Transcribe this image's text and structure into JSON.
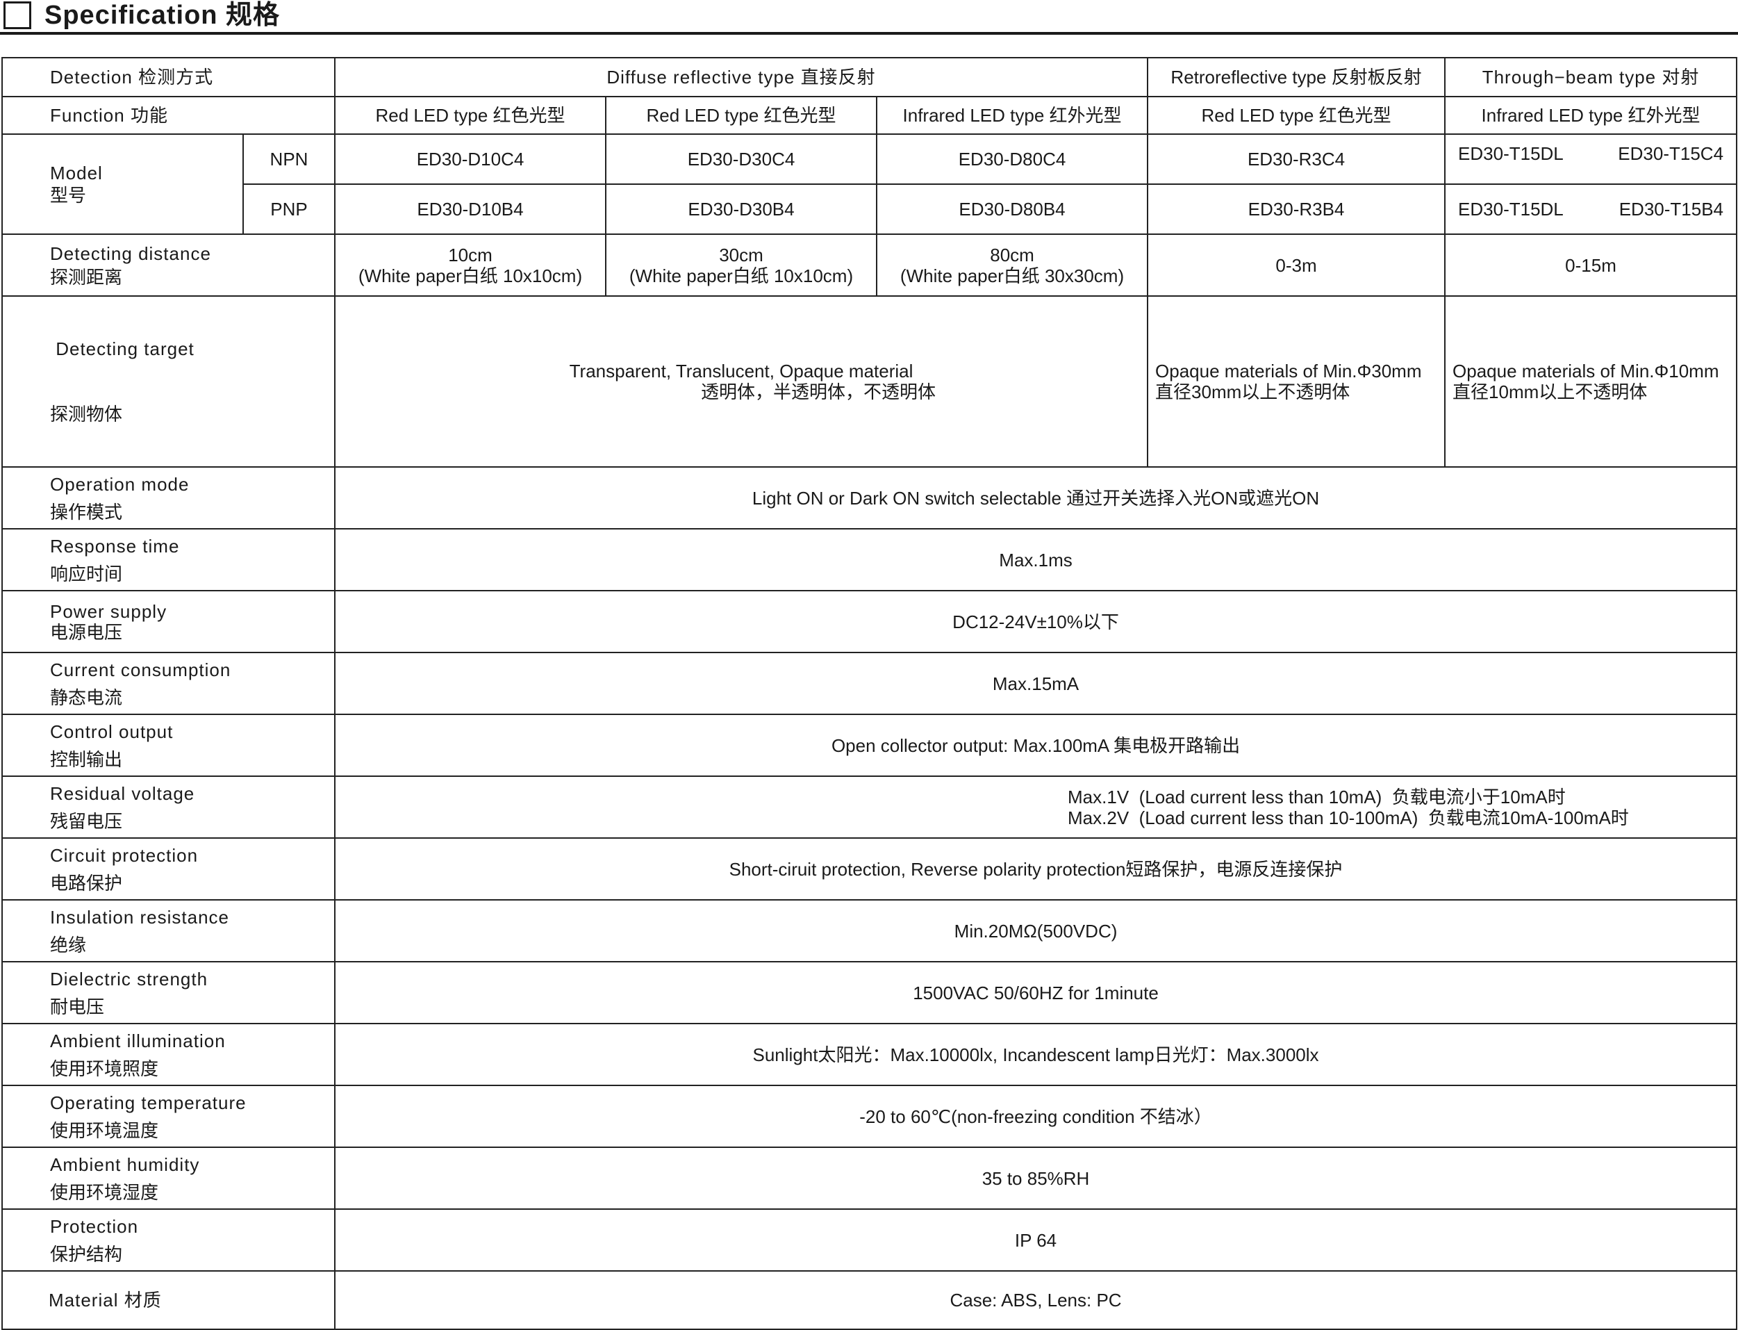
{
  "header": {
    "title": "Specification 规格"
  },
  "table": {
    "detection": {
      "label": "Detection 检测方式",
      "diffuse": "Diffuse reflective type  直接反射",
      "retro": "Retroreflective type 反射板反射",
      "through": "Through−beam type  对射"
    },
    "function": {
      "label": "Function 功能",
      "cells": [
        "Red LED type 红色光型",
        "Red LED type 红色光型",
        "Infrared LED type 红外光型",
        "Red LED type 红色光型",
        "Infrared LED type 红外光型"
      ]
    },
    "model": {
      "label_en": "Model",
      "label_zh": "型号",
      "npn": {
        "label": "NPN",
        "cells": [
          "ED30-D10C4",
          "ED30-D30C4",
          "ED30-D80C4",
          "ED30-R3C4"
        ],
        "through": [
          "ED30-T15DL",
          "ED30-T15C4"
        ]
      },
      "pnp": {
        "label": "PNP",
        "cells": [
          "ED30-D10B4",
          "ED30-D30B4",
          "ED30-D80B4",
          "ED30-R3B4"
        ],
        "through": [
          "ED30-T15DL",
          "ED30-T15B4"
        ]
      }
    },
    "distance": {
      "en": "Detecting distance",
      "zh": "探测距离",
      "d10": [
        "10cm",
        "(White paper白纸 10x10cm)"
      ],
      "d30": [
        "30cm",
        "(White paper白纸 10x10cm)"
      ],
      "d80": [
        "80cm",
        "(White paper白纸 30x30cm)"
      ],
      "retro": "0-3m",
      "through": "0-15m"
    },
    "target": {
      "en": " Detecting target",
      "zh": "探测物体",
      "diffuse": [
        "Transparent, Translucent, Opaque material",
        "透明体，半透明体，不透明体"
      ],
      "retro": [
        "Opaque materials of Min.Φ30mm",
        "直径30mm以上不透明体"
      ],
      "through": [
        "Opaque materials of Min.Φ10mm",
        "直径10mm以上不透明体"
      ]
    },
    "rows": [
      {
        "en": "Operation mode",
        "zh": "操作模式",
        "value": "Light ON or Dark ON switch selectable  通过开关选择入光ON或遮光ON"
      },
      {
        "en": "Response time",
        "zh": "响应时间",
        "value": "Max.1ms"
      },
      {
        "en": "Power supply",
        "zh": "电源电压",
        "value": "DC12-24V±10%以下"
      },
      {
        "en": "Current consumption",
        "zh": "静态电流",
        "value": "Max.15mA"
      },
      {
        "en": "Control output",
        "zh": "控制输出",
        "value": "Open collector output: Max.100mA  集电极开路输出"
      },
      {
        "en": "Residual voltage",
        "zh": "残留电压",
        "value": "Max.1V  (Load current less than 10mA)  负载电流小于10mA时",
        "value2": "Max.2V  (Load current less than 10-100mA)  负载电流10mA-100mA时"
      },
      {
        "en": "Circuit protection",
        "zh": "电路保护",
        "value": "Short-ciruit protection, Reverse polarity protection短路保护，电源反连接保护"
      },
      {
        "en": "Insulation resistance",
        "zh": "绝缘",
        "value": "Min.20MΩ(500VDC)"
      },
      {
        "en": "Dielectric strength",
        "zh": "耐电压",
        "value": "1500VAC 50/60HZ for 1minute"
      },
      {
        "en": "Ambient illumination",
        "zh": "使用环境照度",
        "value": "Sunlight太阳光：Max.10000lx, Incandescent lamp日光灯：Max.3000lx"
      },
      {
        "en": "Operating temperature",
        "zh": "使用环境温度",
        "value": "-20 to 60℃(non-freezing condition 不结冰）"
      },
      {
        "en": "Ambient humidity",
        "zh": "使用环境湿度",
        "value": "35 to 85%RH"
      },
      {
        "en": "Protection",
        "zh": "保护结构",
        "value": "IP 64"
      }
    ],
    "material": {
      "label": "Material 材质",
      "value": "Case: ABS, Lens: PC"
    }
  }
}
